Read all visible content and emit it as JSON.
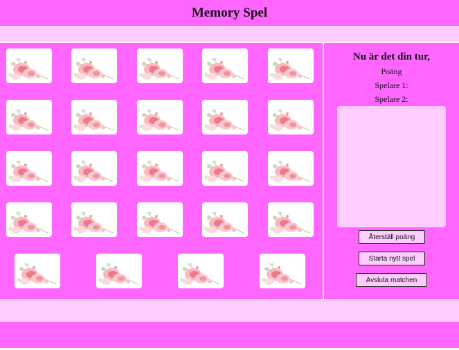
{
  "header": {
    "title": "Memory Spel"
  },
  "panel": {
    "turn_text": "Nu är det din tur,",
    "score_title": "Poäng",
    "player1_label": "Spelare 1:",
    "player2_label": "Spelare 2:",
    "buttons": {
      "reset_score": "Återställ poäng",
      "new_game": "Starta nytt spel",
      "end_match": "Avsluta matchen"
    }
  },
  "board": {
    "card_count": 24,
    "card_state": "face-down",
    "card_back_icon": "rose-flower-icon"
  },
  "colors": {
    "primary": "#ff66ff",
    "light": "#ffccff"
  }
}
